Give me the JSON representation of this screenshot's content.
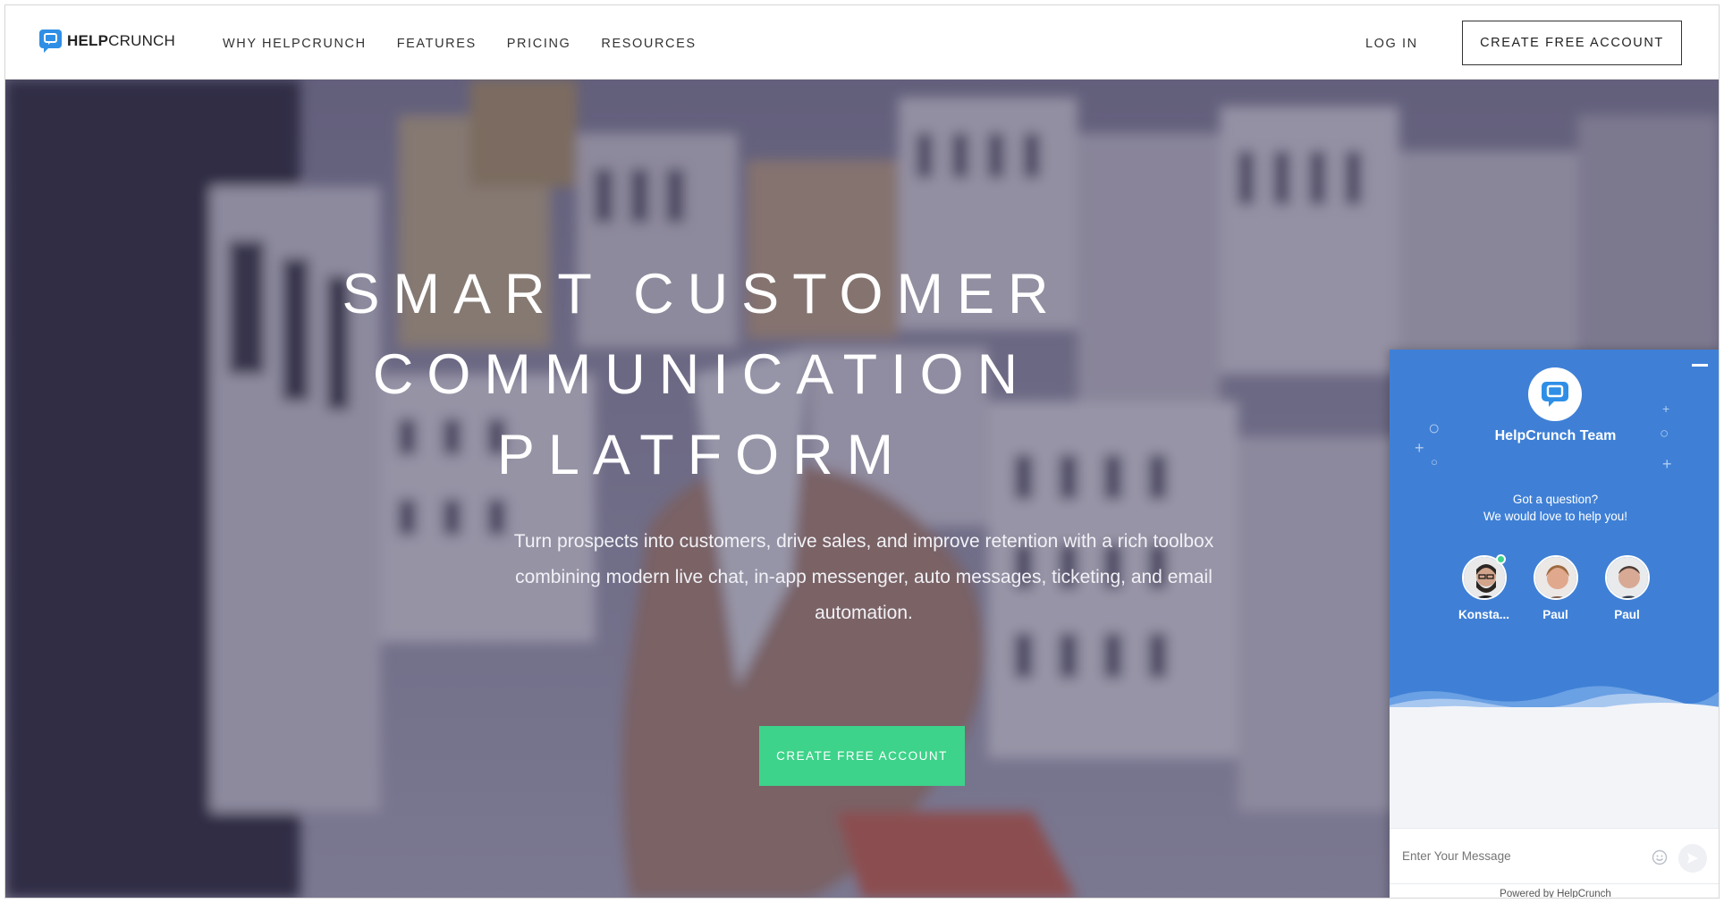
{
  "header": {
    "logo_bold": "HELP",
    "logo_light": "CRUNCH",
    "nav": [
      "WHY HELPCRUNCH",
      "FEATURES",
      "PRICING",
      "RESOURCES"
    ],
    "login": "LOG IN",
    "cta": "CREATE FREE ACCOUNT"
  },
  "hero": {
    "title_lines": [
      "SMART CUSTOMER",
      "COMMUNICATION",
      "PLATFORM"
    ],
    "subtitle": "Turn prospects into customers, drive sales, and improve retention with a rich toolbox combining modern live chat, in-app messenger, auto messages, ticketing, and email automation.",
    "cta": "CREATE FREE ACCOUNT"
  },
  "chat": {
    "team": "HelpCrunch Team",
    "question_line1": "Got a question?",
    "question_line2": "We would love to help you!",
    "agents": [
      {
        "name": "Konsta...",
        "online": true
      },
      {
        "name": "Paul",
        "online": false
      },
      {
        "name": "Paul",
        "online": false
      }
    ],
    "input_placeholder": "Enter Your Message",
    "powered_prefix": "Powered by",
    "powered_link": "HelpCrunch",
    "colors": {
      "brand": "#3f80d6",
      "cta": "#3dd38a"
    }
  }
}
